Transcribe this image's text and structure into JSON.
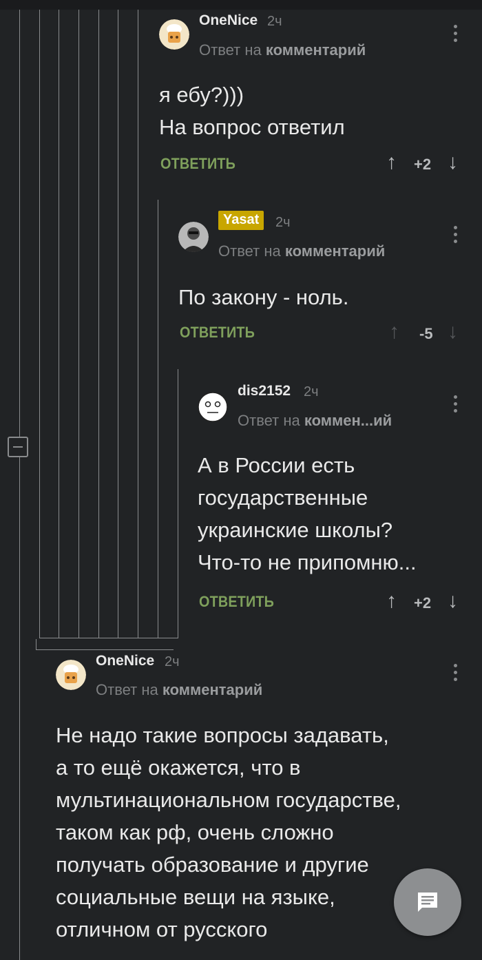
{
  "comments": [
    {
      "username": "OneNice",
      "time": "2ч",
      "reply_prefix": "Ответ на",
      "reply_target": "комментарий",
      "body_lines": [
        "я ебу?)))",
        "На вопрос ответил"
      ],
      "reply_label": "ОТВЕТИТЬ",
      "rating": "+2",
      "avatar": "cook-avatar"
    },
    {
      "username": "Yasat",
      "time": "2ч",
      "reply_prefix": "Ответ на",
      "reply_target": "комментарий",
      "body_lines": [
        "По закону - ноль."
      ],
      "reply_label": "ОТВЕТИТЬ",
      "rating": "-5",
      "avatar": "portrait-avatar"
    },
    {
      "username": "dis2152",
      "time": "2ч",
      "reply_prefix": "Ответ на",
      "reply_target": "коммен...ий",
      "body_lines": [
        "А в России есть",
        "государственные",
        "украинские школы?",
        "Что-то не припомню..."
      ],
      "reply_label": "ОТВЕТИТЬ",
      "rating": "+2",
      "avatar": "poker-face-avatar"
    },
    {
      "username": "OneNice",
      "time": "2ч",
      "reply_prefix": "Ответ на",
      "reply_target": "комментарий",
      "body_lines": [
        "Не надо такие вопросы задавать,",
        "а то ещё окажется, что в",
        "мультинациональном государстве,",
        "таком как рф, очень сложно",
        "получать образование и другие",
        "социальные вещи на языке,",
        "отличном от русского"
      ],
      "avatar": "cook-avatar"
    }
  ],
  "icons": {
    "upvote": "arrow-up-icon",
    "downvote": "arrow-down-icon",
    "menu": "more-vertical-icon",
    "collapse": "collapse-thread-icon",
    "fab": "comment-icon"
  },
  "colors": {
    "background": "#212325",
    "reply_accent": "#7fa05c",
    "badge": "#c8a600",
    "thread_line": "#8a8c8e"
  }
}
